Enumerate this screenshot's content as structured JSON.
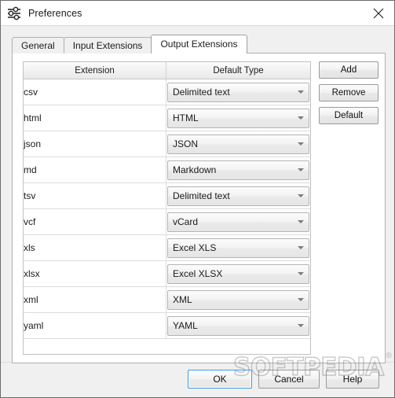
{
  "window": {
    "title": "Preferences",
    "icon": "sliders-icon",
    "close_icon": "close-icon"
  },
  "tabs": [
    {
      "label": "General",
      "active": false
    },
    {
      "label": "Input Extensions",
      "active": false
    },
    {
      "label": "Output Extensions",
      "active": true
    }
  ],
  "table": {
    "columns": [
      "Extension",
      "Default Type"
    ],
    "rows": [
      {
        "extension": "csv",
        "default_type": "Delimited text"
      },
      {
        "extension": "html",
        "default_type": "HTML"
      },
      {
        "extension": "json",
        "default_type": "JSON"
      },
      {
        "extension": "md",
        "default_type": "Markdown"
      },
      {
        "extension": "tsv",
        "default_type": "Delimited text"
      },
      {
        "extension": "vcf",
        "default_type": "vCard"
      },
      {
        "extension": "xls",
        "default_type": "Excel XLS"
      },
      {
        "extension": "xlsx",
        "default_type": "Excel XLSX"
      },
      {
        "extension": "xml",
        "default_type": "XML"
      },
      {
        "extension": "yaml",
        "default_type": "YAML"
      }
    ]
  },
  "side_buttons": [
    {
      "label": "Add"
    },
    {
      "label": "Remove"
    },
    {
      "label": "Default"
    }
  ],
  "dialog_buttons": {
    "ok": "OK",
    "cancel": "Cancel",
    "help": "Help"
  },
  "watermark": {
    "text": "SOFTPEDIA",
    "registered": "®"
  },
  "colors": {
    "accent_focus": "#3d9ae8",
    "window_bg": "#f0f0f0",
    "panel_bg": "#ffffff",
    "border": "#b0b0b0"
  }
}
